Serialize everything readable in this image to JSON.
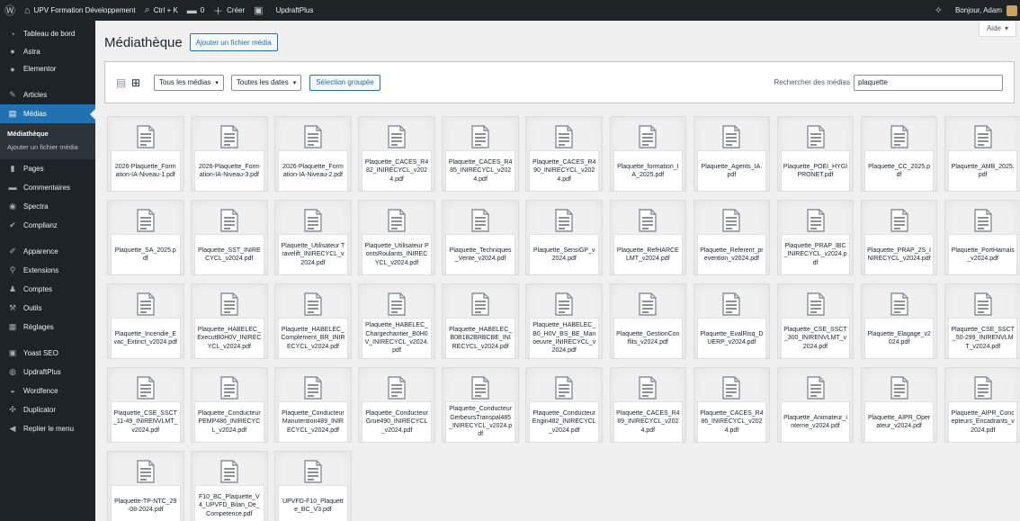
{
  "adminbar": {
    "site_name": "UPV Formation Développement",
    "command_palette": "Ctrl + K",
    "comments_count": "0",
    "new_label": "Créer",
    "updraft_label": "UpdraftPlus",
    "greeting": "Bonjour, Adam"
  },
  "sidebar": {
    "items": [
      {
        "label": "Tableau de bord",
        "icon": "dashboard-icon"
      },
      {
        "label": "Astra",
        "icon": "astra-icon"
      },
      {
        "label": "Elementor",
        "icon": "elementor-icon"
      },
      {
        "label": "Articles",
        "icon": "pin-icon"
      },
      {
        "label": "Médias",
        "icon": "media-icon"
      },
      {
        "label": "Pages",
        "icon": "pages-icon"
      },
      {
        "label": "Commentaires",
        "icon": "comments-icon"
      },
      {
        "label": "Spectra",
        "icon": "spectra-icon"
      },
      {
        "label": "Complianz",
        "icon": "complianz-icon"
      },
      {
        "label": "Apparence",
        "icon": "appearance-icon"
      },
      {
        "label": "Extensions",
        "icon": "plugins-icon"
      },
      {
        "label": "Comptes",
        "icon": "users-icon"
      },
      {
        "label": "Outils",
        "icon": "tools-icon"
      },
      {
        "label": "Réglages",
        "icon": "settings-icon"
      },
      {
        "label": "Yoast SEO",
        "icon": "yoast-icon"
      },
      {
        "label": "UpdraftPlus",
        "icon": "updraftplus-icon"
      },
      {
        "label": "Wordfence",
        "icon": "wordfence-icon"
      },
      {
        "label": "Duplicator",
        "icon": "duplicator-icon"
      },
      {
        "label": "Replier le menu",
        "icon": "collapse-icon"
      }
    ],
    "submenu": {
      "library": "Médiathèque",
      "add_new": "Ajouter un fichier média"
    }
  },
  "main": {
    "help_label": "Aide",
    "title": "Médiathèque",
    "add_media_label": "Ajouter un fichier média",
    "filter_type": "Tous les médias",
    "filter_date": "Toutes les dates",
    "bulk_select_label": "Sélection groupée",
    "search_label": "Rechercher des médias",
    "search_value": "plaquette"
  },
  "files": [
    "2026-Plaquette_Formation-IA-Niveau-1.pdf",
    "2026-Plaquette_Formation-IA-Niveau-3.pdf",
    "2026-Plaquette_Formation-IA-Niveau-2.pdf",
    "Plaquette_CACES_R482_INIRECYCL_v2024.pdf",
    "Plaquette_CACES_R485_INIRECYCL_v2024.pdf",
    "Plaquette_CACES_R490_INIRECYCL_v2024.pdf",
    "Plaquette_formation_IA_2025.pdf",
    "Plaquette_Agents_IA.pdf",
    "Plaquette_POEI_HYGIPRONET.pdf",
    "Plaquette_CC_2025.pdf",
    "Plaquette_AMB_2025.pdf",
    "Plaquette_SA_2025.pdf",
    "Plaquette_SST_INIRECYCL_v2024.pdf",
    "Plaquette_Utilisateur Travelift_INIRECYCL_v2024.pdf",
    "Plaquette_Utilisateur PontsRoulants_INIRECYCL_v2024.pdf",
    "Plaquette_Techniques_Vente_v2024.pdf",
    "Plaquette_SensiGP_v2024.pdf",
    "Plaquette_RefHARCELMT_v2024.pdf",
    "Plaquette_Referent_prevention_v2024.pdf",
    "Plaquette_PRAP_IBC_INIRECYCL_v2024.pdf",
    "Plaquette_PRAP_2S_INIRECYCL_v2024.pdf",
    "Plaquette_PortHamais_v2024.pdf",
    "Plaquette_Incendie_Evac_Extinct_v2024.pdf",
    "Plaquette_HABELEC_ExecutB0H0V_INIRECYCL_v2024.pdf",
    "Plaquette_HABELEC_Complement_BR_INIRECYCL_v2024.pdf",
    "Plaquette_HABELEC_Chargechantier_B0H0V_INIRECYCL_v2024.pdf",
    "Plaquette_HABELEC_B0B1B2BRBCBE_INIRECYCL_v2024.pdf",
    "Plaquette_HABELEC_B0_H0V_BS_BE_Manoeuvre_INIRECYCL_v2024.pdf",
    "Plaquette_GestionConflits_v2024.pdf",
    "Plaquette_EvalRisq_DUERP_v2024.pdf",
    "Plaquette_CSE_SSCT_300_INIRENVLMT_v2024.pdf",
    "Plaquette_Elagage_v2024.pdf",
    "Plaquette_CSE_SSCT_50-299_INIRENVLMT_v2024.pdf",
    "Plaquette_CSE_SSCT_11-49_INIRENVLMT_v2024.pdf",
    "Plaquette_ConducteurPEMP486_INIRECYCL_v2024.pdf",
    "Plaquette_ConducteurManutention489_INIRECYCL_v2024.pdf",
    "Plaquette_ConducteurGrue490_INIRECYCL_v2024.pdf",
    "Plaquette_ConducteurGerbeursTranspal485_INIRECYCL_v2024.pdf",
    "Plaquette_ConducteurEngin482_INIRECYCL_v2024.pdf",
    "Plaquette_CACES_R489_INIRECYCL_v2024.pdf",
    "Plaquette_CACES_R486_INIRECYCL_v2024.pdf",
    "Plaquette_Animateur_interne_v2024.pdf",
    "Plaquette_AIPR_Operateur_v2024.pdf",
    "Plaquette_AIPR_Concepteurs_Encadrants_v2024.pdf",
    "Plaquette-TP-NTC_29-08-2024.pdf",
    "F10_BC_Plaquette_V4_UPVFD_Bilan_De_Competence.pdf",
    "UPVFD-F10_Plaquette_BC_V3.pdf"
  ]
}
